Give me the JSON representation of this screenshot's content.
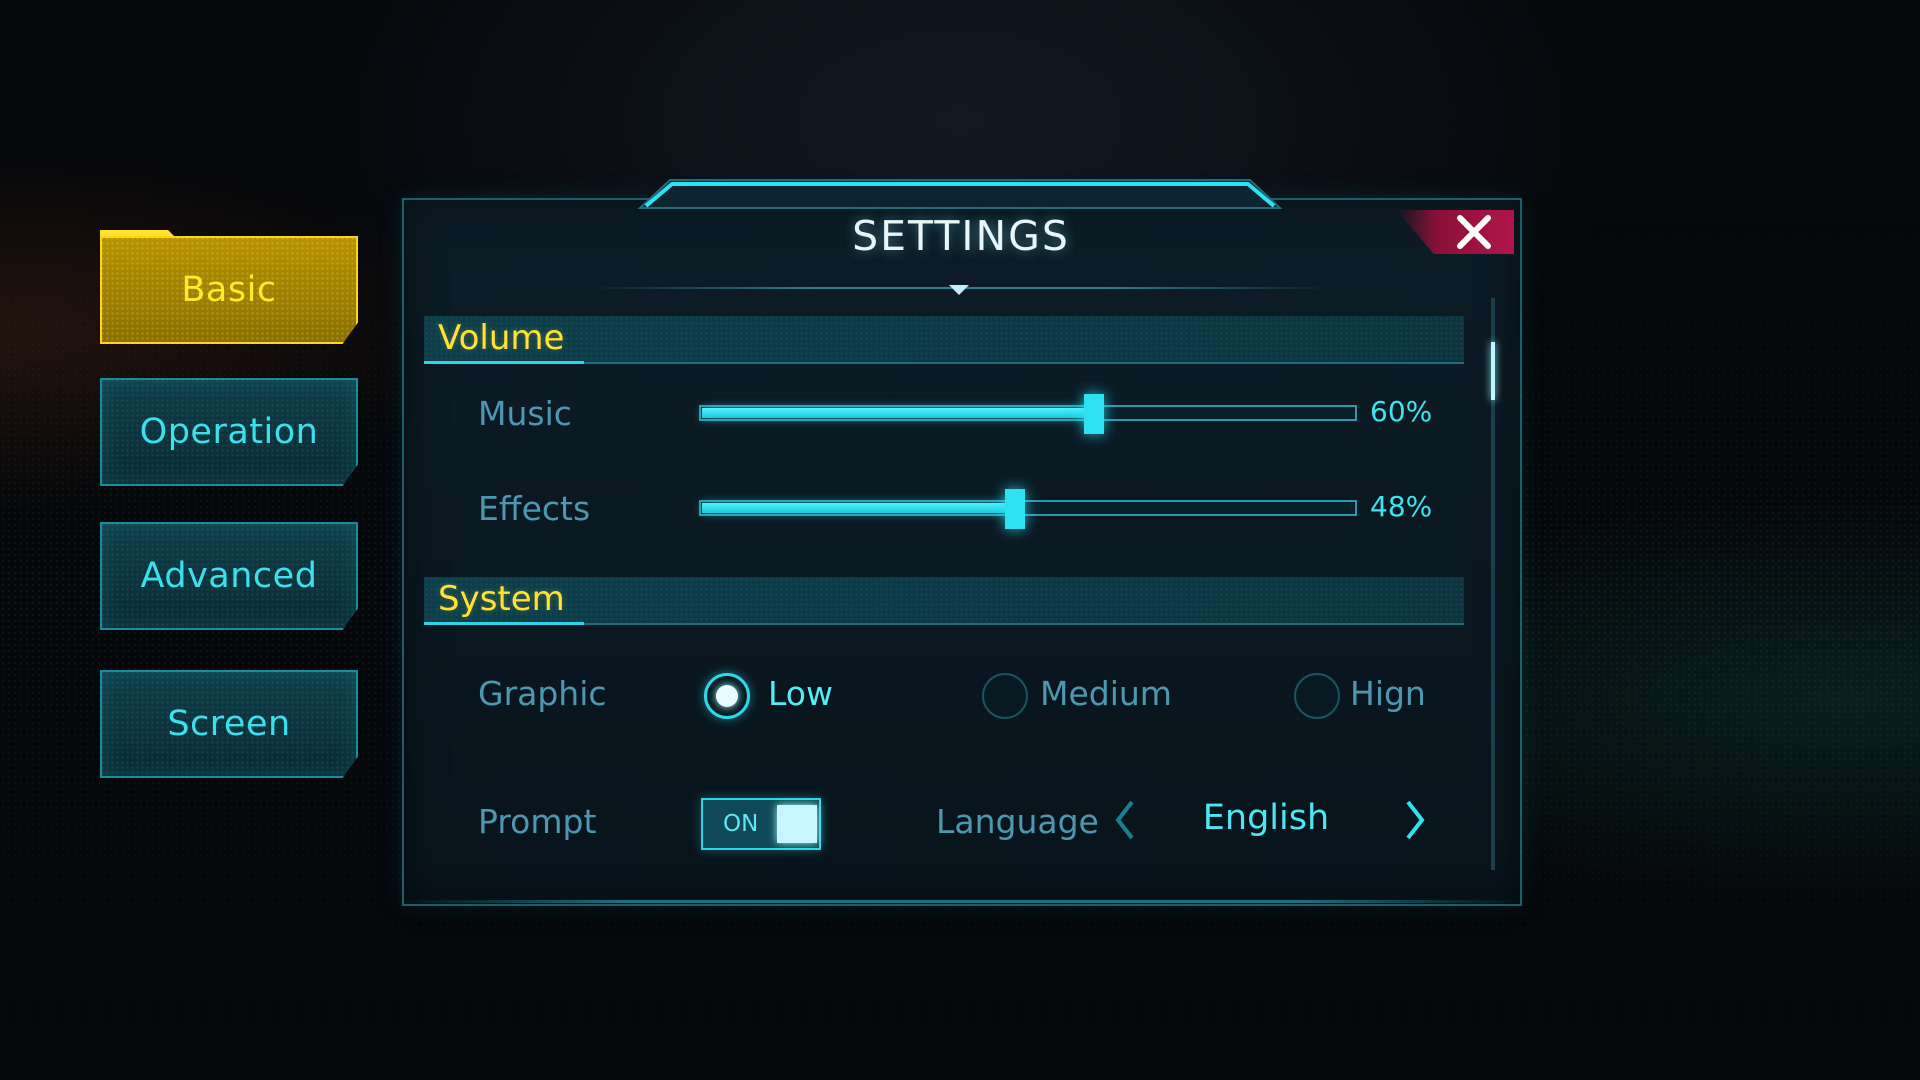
{
  "screen": {
    "title": "SETTINGS",
    "close_icon": "close-icon"
  },
  "tabs": [
    {
      "label": "Basic",
      "active": true
    },
    {
      "label": "Operation",
      "active": false
    },
    {
      "label": "Advanced",
      "active": false
    },
    {
      "label": "Screen",
      "active": false
    }
  ],
  "volume": {
    "header": "Volume",
    "music": {
      "label": "Music",
      "value_text": "60%",
      "value": 0.6
    },
    "effects": {
      "label": "Effects",
      "value_text": "48%",
      "value": 0.48
    }
  },
  "system": {
    "header": "System",
    "graphic": {
      "label": "Graphic",
      "options": [
        "Low",
        "Medium",
        "Hign"
      ],
      "selected": "Low"
    },
    "prompt": {
      "label": "Prompt",
      "state_text": "ON",
      "on": true
    },
    "language": {
      "label": "Language",
      "value": "English",
      "prev_icon": "chevron-left-icon",
      "next_icon": "chevron-right-icon"
    }
  },
  "colors": {
    "accent": "#2bd5e6",
    "active_tab": "#ffd21a",
    "section_title": "#ffe234",
    "close": "#b0154a"
  }
}
